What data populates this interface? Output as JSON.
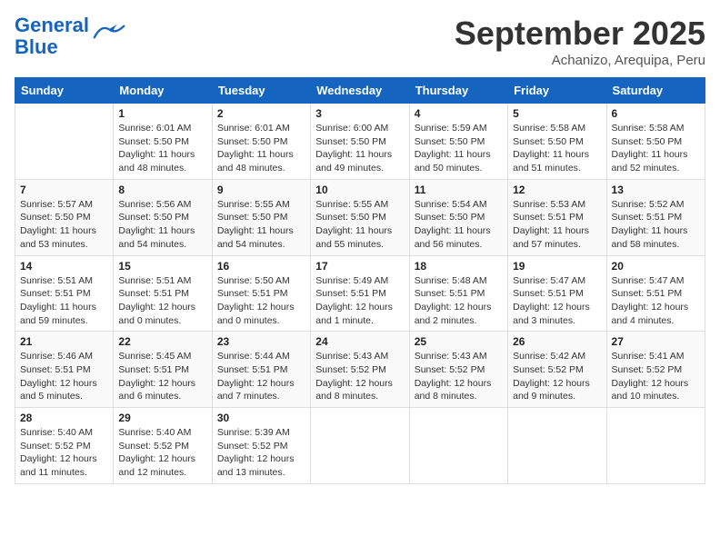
{
  "logo": {
    "line1": "General",
    "line2": "Blue"
  },
  "title": "September 2025",
  "subtitle": "Achanizo, Arequipa, Peru",
  "days_of_week": [
    "Sunday",
    "Monday",
    "Tuesday",
    "Wednesday",
    "Thursday",
    "Friday",
    "Saturday"
  ],
  "weeks": [
    [
      {
        "day": "",
        "info": ""
      },
      {
        "day": "1",
        "info": "Sunrise: 6:01 AM\nSunset: 5:50 PM\nDaylight: 11 hours\nand 48 minutes."
      },
      {
        "day": "2",
        "info": "Sunrise: 6:01 AM\nSunset: 5:50 PM\nDaylight: 11 hours\nand 48 minutes."
      },
      {
        "day": "3",
        "info": "Sunrise: 6:00 AM\nSunset: 5:50 PM\nDaylight: 11 hours\nand 49 minutes."
      },
      {
        "day": "4",
        "info": "Sunrise: 5:59 AM\nSunset: 5:50 PM\nDaylight: 11 hours\nand 50 minutes."
      },
      {
        "day": "5",
        "info": "Sunrise: 5:58 AM\nSunset: 5:50 PM\nDaylight: 11 hours\nand 51 minutes."
      },
      {
        "day": "6",
        "info": "Sunrise: 5:58 AM\nSunset: 5:50 PM\nDaylight: 11 hours\nand 52 minutes."
      }
    ],
    [
      {
        "day": "7",
        "info": "Sunrise: 5:57 AM\nSunset: 5:50 PM\nDaylight: 11 hours\nand 53 minutes."
      },
      {
        "day": "8",
        "info": "Sunrise: 5:56 AM\nSunset: 5:50 PM\nDaylight: 11 hours\nand 54 minutes."
      },
      {
        "day": "9",
        "info": "Sunrise: 5:55 AM\nSunset: 5:50 PM\nDaylight: 11 hours\nand 54 minutes."
      },
      {
        "day": "10",
        "info": "Sunrise: 5:55 AM\nSunset: 5:50 PM\nDaylight: 11 hours\nand 55 minutes."
      },
      {
        "day": "11",
        "info": "Sunrise: 5:54 AM\nSunset: 5:50 PM\nDaylight: 11 hours\nand 56 minutes."
      },
      {
        "day": "12",
        "info": "Sunrise: 5:53 AM\nSunset: 5:51 PM\nDaylight: 11 hours\nand 57 minutes."
      },
      {
        "day": "13",
        "info": "Sunrise: 5:52 AM\nSunset: 5:51 PM\nDaylight: 11 hours\nand 58 minutes."
      }
    ],
    [
      {
        "day": "14",
        "info": "Sunrise: 5:51 AM\nSunset: 5:51 PM\nDaylight: 11 hours\nand 59 minutes."
      },
      {
        "day": "15",
        "info": "Sunrise: 5:51 AM\nSunset: 5:51 PM\nDaylight: 12 hours\nand 0 minutes."
      },
      {
        "day": "16",
        "info": "Sunrise: 5:50 AM\nSunset: 5:51 PM\nDaylight: 12 hours\nand 0 minutes."
      },
      {
        "day": "17",
        "info": "Sunrise: 5:49 AM\nSunset: 5:51 PM\nDaylight: 12 hours\nand 1 minute."
      },
      {
        "day": "18",
        "info": "Sunrise: 5:48 AM\nSunset: 5:51 PM\nDaylight: 12 hours\nand 2 minutes."
      },
      {
        "day": "19",
        "info": "Sunrise: 5:47 AM\nSunset: 5:51 PM\nDaylight: 12 hours\nand 3 minutes."
      },
      {
        "day": "20",
        "info": "Sunrise: 5:47 AM\nSunset: 5:51 PM\nDaylight: 12 hours\nand 4 minutes."
      }
    ],
    [
      {
        "day": "21",
        "info": "Sunrise: 5:46 AM\nSunset: 5:51 PM\nDaylight: 12 hours\nand 5 minutes."
      },
      {
        "day": "22",
        "info": "Sunrise: 5:45 AM\nSunset: 5:51 PM\nDaylight: 12 hours\nand 6 minutes."
      },
      {
        "day": "23",
        "info": "Sunrise: 5:44 AM\nSunset: 5:51 PM\nDaylight: 12 hours\nand 7 minutes."
      },
      {
        "day": "24",
        "info": "Sunrise: 5:43 AM\nSunset: 5:52 PM\nDaylight: 12 hours\nand 8 minutes."
      },
      {
        "day": "25",
        "info": "Sunrise: 5:43 AM\nSunset: 5:52 PM\nDaylight: 12 hours\nand 8 minutes."
      },
      {
        "day": "26",
        "info": "Sunrise: 5:42 AM\nSunset: 5:52 PM\nDaylight: 12 hours\nand 9 minutes."
      },
      {
        "day": "27",
        "info": "Sunrise: 5:41 AM\nSunset: 5:52 PM\nDaylight: 12 hours\nand 10 minutes."
      }
    ],
    [
      {
        "day": "28",
        "info": "Sunrise: 5:40 AM\nSunset: 5:52 PM\nDaylight: 12 hours\nand 11 minutes."
      },
      {
        "day": "29",
        "info": "Sunrise: 5:40 AM\nSunset: 5:52 PM\nDaylight: 12 hours\nand 12 minutes."
      },
      {
        "day": "30",
        "info": "Sunrise: 5:39 AM\nSunset: 5:52 PM\nDaylight: 12 hours\nand 13 minutes."
      },
      {
        "day": "",
        "info": ""
      },
      {
        "day": "",
        "info": ""
      },
      {
        "day": "",
        "info": ""
      },
      {
        "day": "",
        "info": ""
      }
    ]
  ]
}
